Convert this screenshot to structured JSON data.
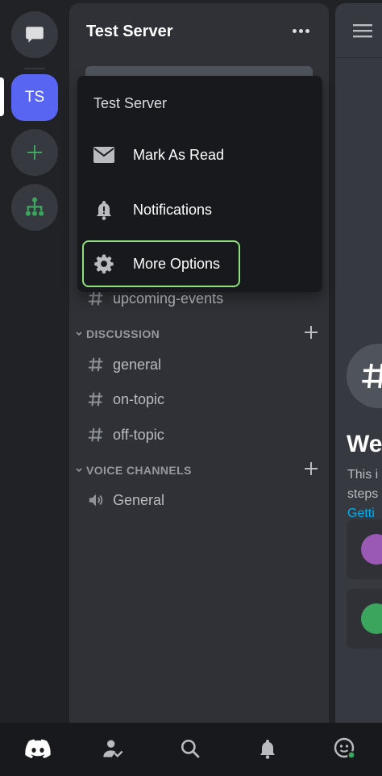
{
  "rail": {
    "server_initials": "TS"
  },
  "server": {
    "name": "Test Server"
  },
  "context_menu": {
    "title": "Test Server",
    "items": [
      {
        "label": "Mark As Read",
        "icon": "envelope-icon"
      },
      {
        "label": "Notifications",
        "icon": "bell-icon"
      },
      {
        "label": "More Options",
        "icon": "gear-icon",
        "highlighted": true
      }
    ]
  },
  "channels": {
    "upcoming": "upcoming-events",
    "categories": [
      {
        "name": "DISCUSSION",
        "channels": [
          "general",
          "on-topic",
          "off-topic"
        ]
      },
      {
        "name": "VOICE CHANNELS",
        "channels": [
          "General"
        ]
      }
    ]
  },
  "main": {
    "welcome_title": "We",
    "desc_line1": "This i",
    "desc_line2": "steps",
    "link": "Getti"
  },
  "colors": {
    "blurple": "#5865f2",
    "green": "#3ba55d",
    "highlight_outline": "#8ee07d",
    "link": "#00aff4"
  }
}
